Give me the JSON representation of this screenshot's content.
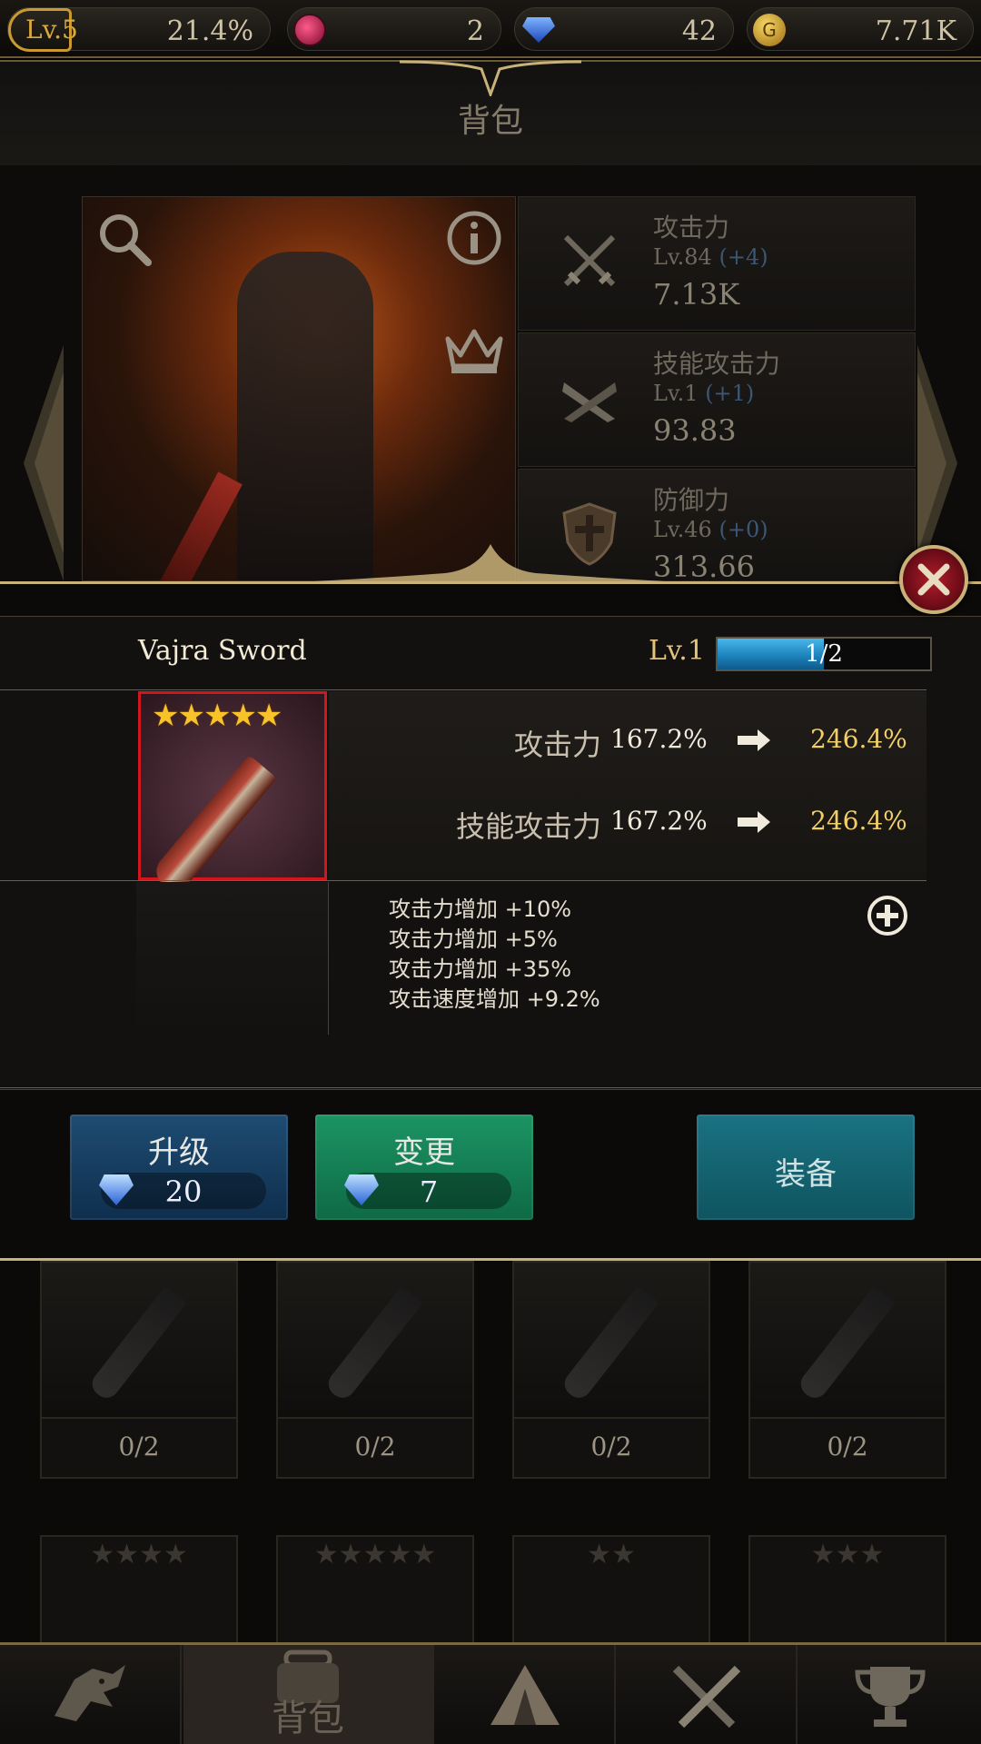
{
  "topbar": {
    "level": "Lv.5",
    "level_progress": "21.4%",
    "rubies": "2",
    "sapphires": "42",
    "gold": "7.71K"
  },
  "header": {
    "title": "背包"
  },
  "hero_stats": [
    {
      "label": "攻击力",
      "lv": "Lv.84",
      "bonus": "(+4)",
      "value": "7.13K",
      "icon": "crossed-swords-icon"
    },
    {
      "label": "技能攻击力",
      "lv": "Lv.1",
      "bonus": "(+1)",
      "value": "93.83",
      "icon": "crossed-blades-icon"
    },
    {
      "label": "防御力",
      "lv": "Lv.46",
      "bonus": "(+0)",
      "value": "313.66",
      "icon": "shield-icon"
    }
  ],
  "item": {
    "name": "Vajra Sword",
    "level": "Lv.1",
    "exp_text": "1/2",
    "exp_fraction": 0.5,
    "stars": "★★★★★",
    "stats": [
      {
        "label": "攻击力",
        "current": "167.2%",
        "next": "246.4%"
      },
      {
        "label": "技能攻击力",
        "current": "167.2%",
        "next": "246.4%"
      }
    ],
    "options": [
      "攻击力增加 +10%",
      "攻击力增加 +5%",
      "攻击力增加 +35%",
      "攻击速度增加 +9.2%"
    ]
  },
  "actions": {
    "upgrade": {
      "label": "升级",
      "cost": "20"
    },
    "change": {
      "label": "变更",
      "cost": "7"
    },
    "equip": {
      "label": "装备"
    }
  },
  "inventory": {
    "row1_counts": [
      "0/2",
      "0/2",
      "0/2",
      "0/2"
    ],
    "row2_stars": [
      "★★★★",
      "★★★★★",
      "★★",
      "★★★"
    ]
  },
  "bottom_nav": {
    "active_label": "背包",
    "tabs": [
      "dragon-icon",
      "backpack-icon",
      "camp-tent-icon",
      "crossed-swords-icon",
      "trophy-icon"
    ]
  },
  "colors": {
    "accent_gold": "#c9b27a",
    "rarity_red": "#d2161d",
    "stat_upgrade": "#f0cf6b",
    "upgrade_btn": "#1e4c72",
    "change_btn": "#1c9463",
    "equip_btn": "#1a7282"
  }
}
